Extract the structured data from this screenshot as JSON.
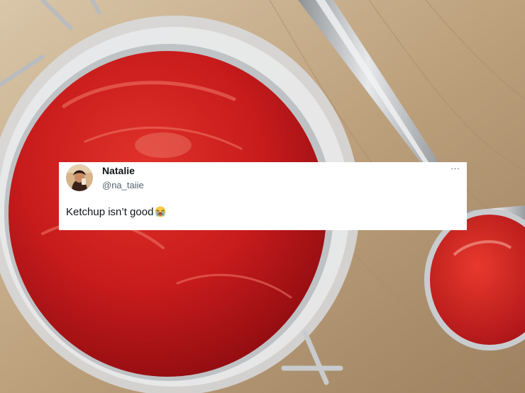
{
  "tweet": {
    "name": "Natalie",
    "handle": "@na_taiie",
    "more": "···",
    "text": "Ketchup isn’t good",
    "emoji": "loudly-crying-face"
  },
  "colors": {
    "ketchup": "#c4161c",
    "wood": "#b9a07f",
    "card": "#ffffff",
    "name": "#0f1419",
    "handle": "#536471"
  }
}
